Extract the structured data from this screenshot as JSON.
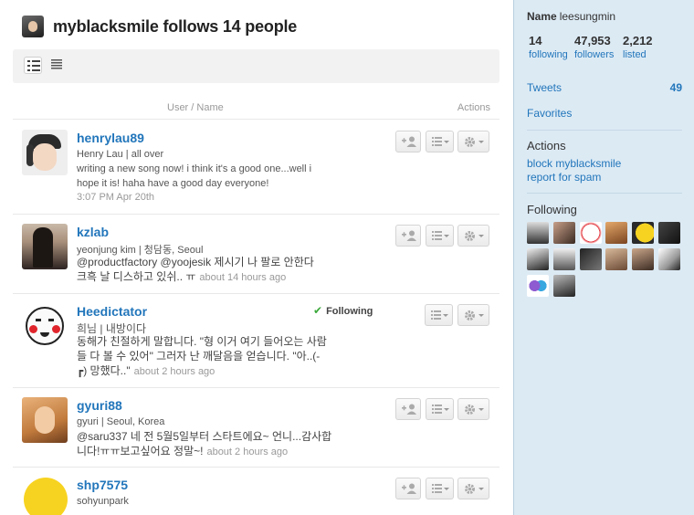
{
  "page": {
    "heading": "myblacksmile follows 14 people",
    "col_user": "User / Name",
    "col_actions": "Actions"
  },
  "icons": {
    "view_list": "list-view-icon",
    "view_compact": "compact-view-icon",
    "follow": "add-person-icon",
    "lists": "lists-menu-icon",
    "gear": "gear-icon",
    "check": "check-icon"
  },
  "colors": {
    "link": "#2276bb",
    "sidebar_bg": "#dceaf4",
    "following_check": "#3ba93b"
  },
  "users": [
    {
      "screen_name": "henrylau89",
      "name_line": "Henry Lau | all over",
      "tweet": "writing a new song now! i think it's a good one...well i hope it is! haha have a good day everyone!",
      "time": "3:07 PM Apr 20th"
    },
    {
      "screen_name": "kzlab",
      "name_line": "yeonjung kim | 청담동, Seoul",
      "tweet": "@productfactory @yoojesik 제시기 나 팔로 안한다 크흑 날 디스하고 있쉬.. ㅠ",
      "time": "about 14 hours ago"
    },
    {
      "screen_name": "Heedictator",
      "following_label": "Following",
      "name_line": "희님 | 내방이다",
      "tweet": "동해가 친절하게 말합니다. \"형 이거 여기 들어오는 사람들 다 볼 수 있어\" 그러자 난 깨달음을 얻습니다. \"아..(- ┏) 망했다..\"",
      "time": "about 2 hours ago"
    },
    {
      "screen_name": "gyuri88",
      "name_line": "gyuri | Seoul, Korea",
      "tweet": "@saru337 네 전 5월5일부터 스타트에요~ 언니...감사합니다!ㅠㅠ보고싶어요 정말~!",
      "time": "about 2 hours ago"
    },
    {
      "screen_name": "shp7575",
      "name_line": "sohyunpark",
      "tweet": "",
      "time": ""
    }
  ],
  "sidebar": {
    "name_label": "Name",
    "name": "leesungmin",
    "stats": [
      {
        "count": "14",
        "label": "following"
      },
      {
        "count": "47,953",
        "label": "followers"
      },
      {
        "count": "2,212",
        "label": "listed"
      }
    ],
    "tweets_label": "Tweets",
    "tweets_count": "49",
    "favorites_label": "Favorites",
    "actions_heading": "Actions",
    "block_label": "block myblacksmile",
    "report_label": "report for spam",
    "following_heading": "Following"
  }
}
